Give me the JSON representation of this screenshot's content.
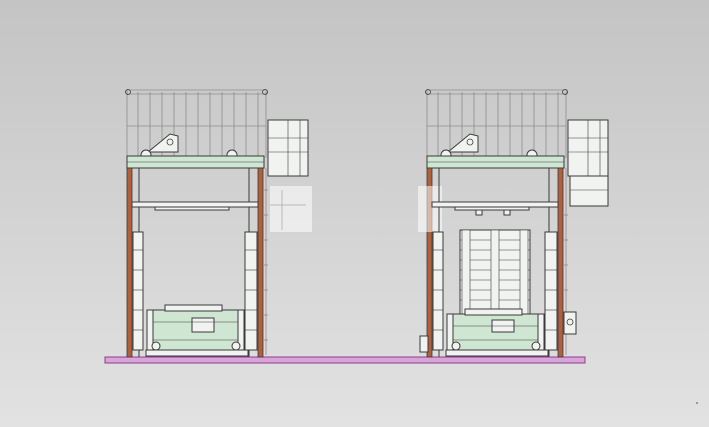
{
  "viewer": {
    "background_top": "#c4c4c4",
    "background_bottom": "#e2e2e2"
  },
  "colors": {
    "outline": "#3a3a3a",
    "frame_fill": "#f1f3f1",
    "green_fill": "#cfe6d3",
    "column": "#b0603a",
    "railing": "#8c8c8c",
    "floor": "#d9a5d8",
    "floor_edge": "#8a3f8a",
    "cable_yellow": "#e8e6b0"
  },
  "machines": [
    {
      "id": "left",
      "state": "empty"
    },
    {
      "id": "right",
      "state": "with-pallet-stack"
    }
  ]
}
